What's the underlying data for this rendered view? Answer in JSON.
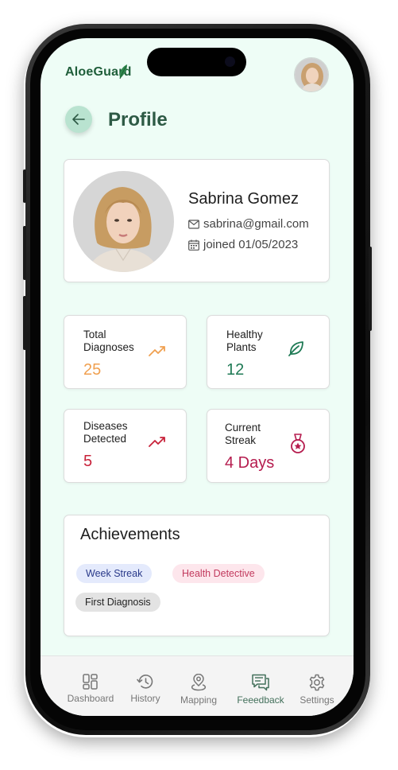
{
  "app": {
    "logo_text": "AloeGuard"
  },
  "header": {
    "title": "Profile"
  },
  "profile": {
    "name": "Sabrina Gomez",
    "email": "sabrina@gmail.com",
    "joined": "joined 01/05/2023"
  },
  "stats": [
    {
      "label": "Total\nDiagnoses",
      "value": "25",
      "color": "#f0a050",
      "icon": "trending-up-icon"
    },
    {
      "label": "Healthy\nPlants",
      "value": "12",
      "color": "#1f7a55",
      "icon": "leaf-icon"
    },
    {
      "label": "Diseases\nDetected",
      "value": "5",
      "color": "#c8223a",
      "icon": "trending-up-icon"
    },
    {
      "label": "Current\nStreak",
      "value": "4 Days",
      "color": "#b51c4e",
      "icon": "medal-icon"
    }
  ],
  "achievements": {
    "title": "Achievements",
    "badges": [
      {
        "label": "Week Streak",
        "bg": "#e4eafc",
        "color": "#2a3a8a"
      },
      {
        "label": "Health Detective",
        "bg": "#fde6ec",
        "color": "#c23a5e"
      },
      {
        "label": "First Diagnosis",
        "bg": "#e3e3e3",
        "color": "#222222"
      }
    ]
  },
  "nav": [
    {
      "label": "Dashboard",
      "icon": "dashboard-icon"
    },
    {
      "label": "History",
      "icon": "history-icon"
    },
    {
      "label": "Mapping",
      "icon": "map-pin-icon"
    },
    {
      "label": "Feeedback",
      "icon": "feedback-icon",
      "active": true
    },
    {
      "label": "Settings",
      "icon": "gear-icon"
    }
  ]
}
